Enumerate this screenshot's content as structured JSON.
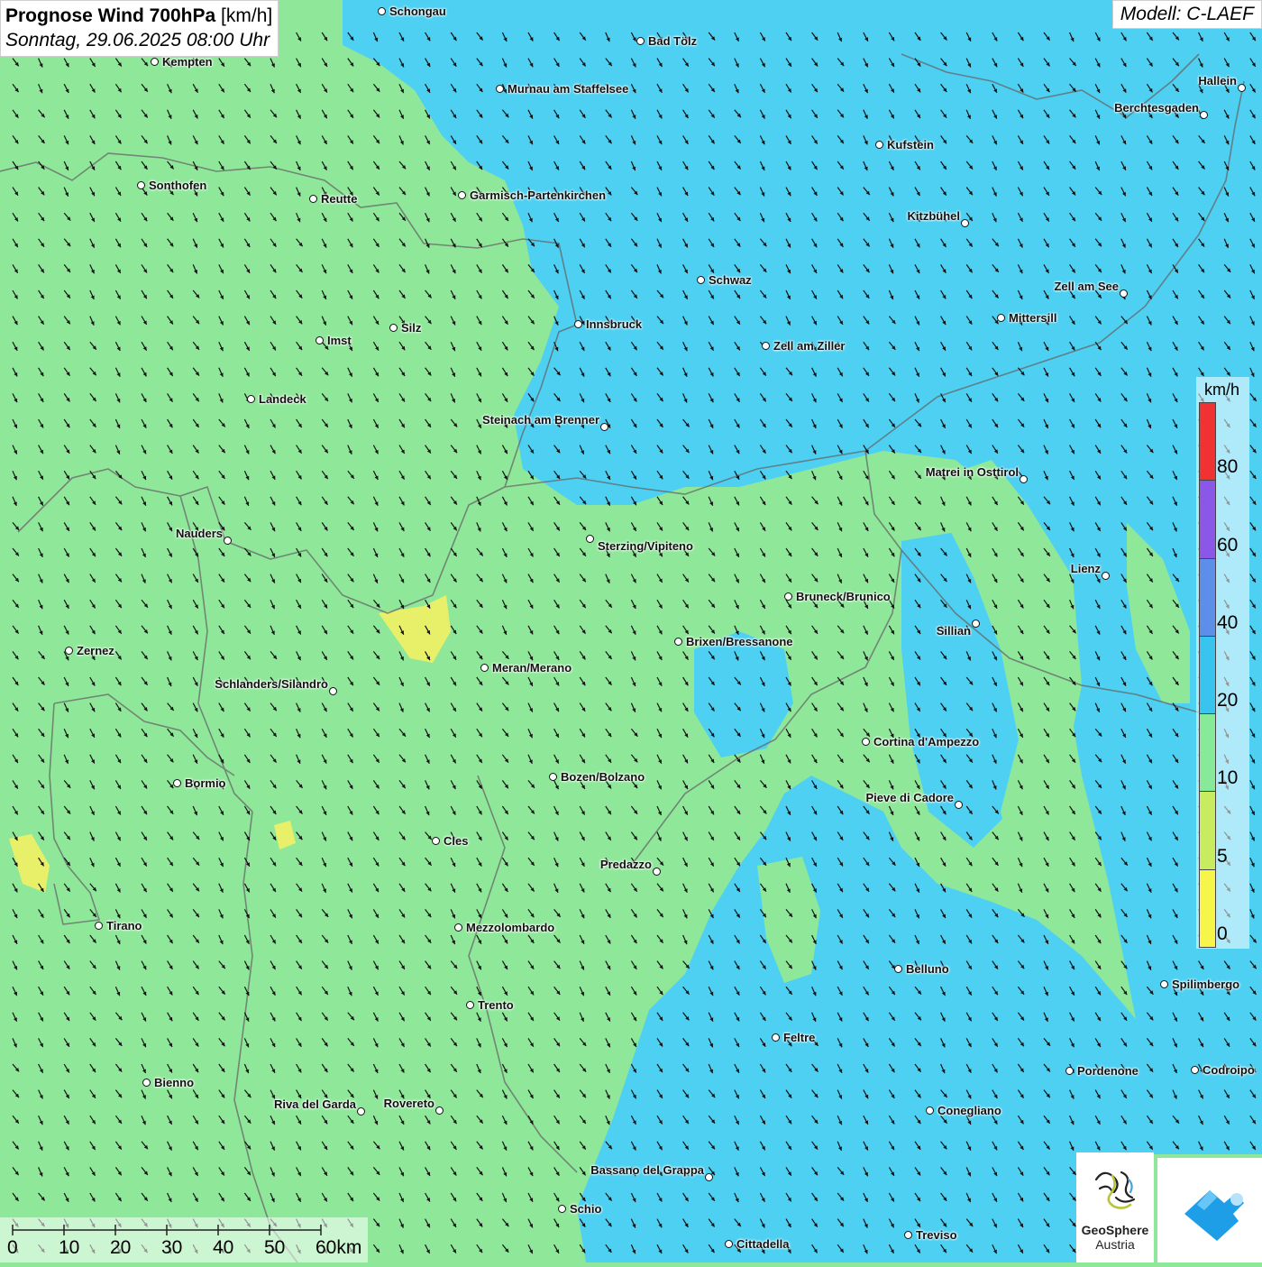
{
  "title": {
    "main_bold": "Prognose Wind 700hPa",
    "main_unit": "[km/h]",
    "subtitle": "Sonntag, 29.06.2025 08:00 Uhr"
  },
  "model": "Modell: C-LAEF",
  "legend": {
    "unit": "km/h",
    "labels": [
      "0",
      "5",
      "10",
      "20",
      "40",
      "60",
      "80"
    ],
    "colors": [
      "#f5f54a",
      "#c8ec60",
      "#86ea98",
      "#39c4f0",
      "#5d8eea",
      "#8a57e8",
      "#f03232"
    ]
  },
  "scalebar": {
    "labels": [
      "0",
      "10",
      "20",
      "30",
      "40",
      "50",
      "60km"
    ]
  },
  "logos": {
    "geosphere_line1": "GeoSphere",
    "geosphere_line2": "Austria",
    "app_icon": "mountain-cloud-icon"
  },
  "map_colors": {
    "light_wind": "#8fe89a",
    "moderate_wind": "#4dd0f2",
    "calm": "#e8f06a"
  },
  "cities": [
    {
      "name": "Schongau"
    },
    {
      "name": "Bad Tölz"
    },
    {
      "name": "Kempten"
    },
    {
      "name": "Murnau am Staffelsee"
    },
    {
      "name": "Hallein"
    },
    {
      "name": "Berchtesgaden"
    },
    {
      "name": "Kufstein"
    },
    {
      "name": "Sonthofen"
    },
    {
      "name": "Reutte"
    },
    {
      "name": "Garmisch-Partenkirchen"
    },
    {
      "name": "Kitzbühel"
    },
    {
      "name": "Schwaz"
    },
    {
      "name": "Zell am See"
    },
    {
      "name": "Innsbruck"
    },
    {
      "name": "Mittersill"
    },
    {
      "name": "Silz"
    },
    {
      "name": "Imst"
    },
    {
      "name": "Zell am Ziller"
    },
    {
      "name": "Landeck"
    },
    {
      "name": "Steinach am Brenner"
    },
    {
      "name": "Matrei in Osttirol"
    },
    {
      "name": "Nauders"
    },
    {
      "name": "Sterzing/Vipiteno"
    },
    {
      "name": "Lienz"
    },
    {
      "name": "Bruneck/Brunico"
    },
    {
      "name": "Sillian"
    },
    {
      "name": "Brixen/Bressanone"
    },
    {
      "name": "Zernez"
    },
    {
      "name": "Meran/Merano"
    },
    {
      "name": "Schlanders/Silandro"
    },
    {
      "name": "Cortina d'Ampezzo"
    },
    {
      "name": "Bormio"
    },
    {
      "name": "Bozen/Bolzano"
    },
    {
      "name": "Pieve di Cadore"
    },
    {
      "name": "Cles"
    },
    {
      "name": "Predazzo"
    },
    {
      "name": "Tirano"
    },
    {
      "name": "Mezzolombardo"
    },
    {
      "name": "Belluno"
    },
    {
      "name": "Spilimbergo"
    },
    {
      "name": "Trento"
    },
    {
      "name": "Feltre"
    },
    {
      "name": "Bienno"
    },
    {
      "name": "Pordenone"
    },
    {
      "name": "Codroipo"
    },
    {
      "name": "Riva del Garda"
    },
    {
      "name": "Rovereto"
    },
    {
      "name": "Conegliano"
    },
    {
      "name": "Bassano del Grappa"
    },
    {
      "name": "Schio"
    },
    {
      "name": "Treviso"
    },
    {
      "name": "Cittadella"
    }
  ]
}
